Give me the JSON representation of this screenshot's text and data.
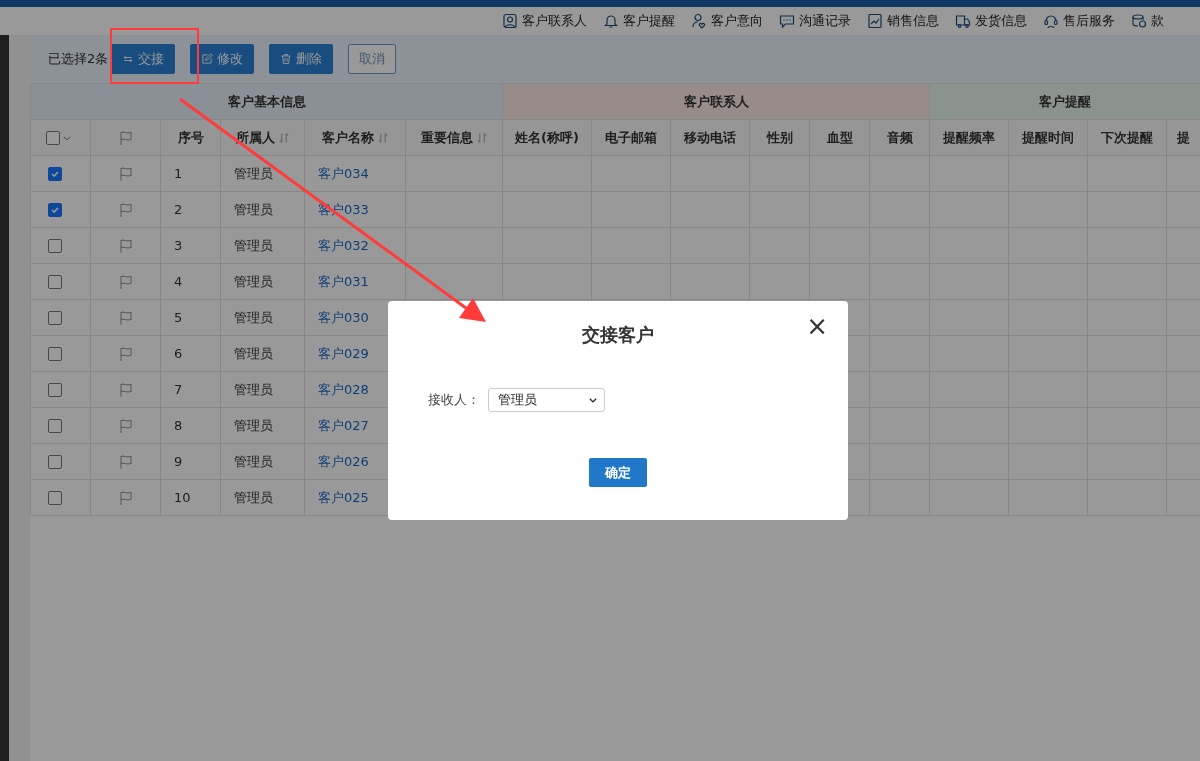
{
  "top_nav": [
    {
      "label": "客户联系人",
      "kind": "contact"
    },
    {
      "label": "客户提醒",
      "kind": "bell"
    },
    {
      "label": "客户意向",
      "kind": "intent"
    },
    {
      "label": "沟通记录",
      "kind": "chat"
    },
    {
      "label": "销售信息",
      "kind": "chart"
    },
    {
      "label": "发货信息",
      "kind": "truck"
    },
    {
      "label": "售后服务",
      "kind": "headset"
    },
    {
      "label": "款",
      "kind": "coins"
    }
  ],
  "toolbar": {
    "selection_text": "已选择2条",
    "buttons": [
      {
        "label": "交接",
        "kind": "transfer"
      },
      {
        "label": "修改",
        "kind": "edit"
      },
      {
        "label": "删除",
        "kind": "delete"
      },
      {
        "label": "取消",
        "kind": "plain"
      }
    ]
  },
  "table": {
    "column_groups": [
      {
        "label": "客户基本信息",
        "color": "#8a9096"
      },
      {
        "label": "客户联系人",
        "color": "#978c8a"
      },
      {
        "label": "客户提醒",
        "color": "#8a938c"
      }
    ],
    "select_all": {
      "checked": false
    },
    "columns": [
      {
        "label": "序号",
        "sortable": false
      },
      {
        "label": "所属人",
        "sortable": true
      },
      {
        "label": "客户名称",
        "sortable": true
      },
      {
        "label": "重要信息",
        "sortable": true
      },
      {
        "label": "姓名(称呼)",
        "sortable": false
      },
      {
        "label": "电子邮箱",
        "sortable": false
      },
      {
        "label": "移动电话",
        "sortable": false
      },
      {
        "label": "性别",
        "sortable": false
      },
      {
        "label": "血型",
        "sortable": false
      },
      {
        "label": "音频",
        "sortable": false
      },
      {
        "label": "提醒频率",
        "sortable": false
      },
      {
        "label": "提醒时间",
        "sortable": false
      },
      {
        "label": "下次提醒",
        "sortable": false
      },
      {
        "label": "提",
        "sortable": false
      }
    ],
    "rows": [
      {
        "checked": true,
        "number": "1",
        "owner": "管理员",
        "name": "客户034"
      },
      {
        "checked": true,
        "number": "2",
        "owner": "管理员",
        "name": "客户033"
      },
      {
        "checked": false,
        "number": "3",
        "owner": "管理员",
        "name": "客户032"
      },
      {
        "checked": false,
        "number": "4",
        "owner": "管理员",
        "name": "客户031"
      },
      {
        "checked": false,
        "number": "5",
        "owner": "管理员",
        "name": "客户030"
      },
      {
        "checked": false,
        "number": "6",
        "owner": "管理员",
        "name": "客户029"
      },
      {
        "checked": false,
        "number": "7",
        "owner": "管理员",
        "name": "客户028"
      },
      {
        "checked": false,
        "number": "8",
        "owner": "管理员",
        "name": "客户027"
      },
      {
        "checked": false,
        "number": "9",
        "owner": "管理员",
        "name": "客户026"
      },
      {
        "checked": false,
        "number": "10",
        "owner": "管理员",
        "name": "客户025"
      }
    ]
  },
  "dialog": {
    "title": "交接客户",
    "close": "×",
    "field_label": "接收人：",
    "select_value": "管理员",
    "confirm": "确定"
  }
}
